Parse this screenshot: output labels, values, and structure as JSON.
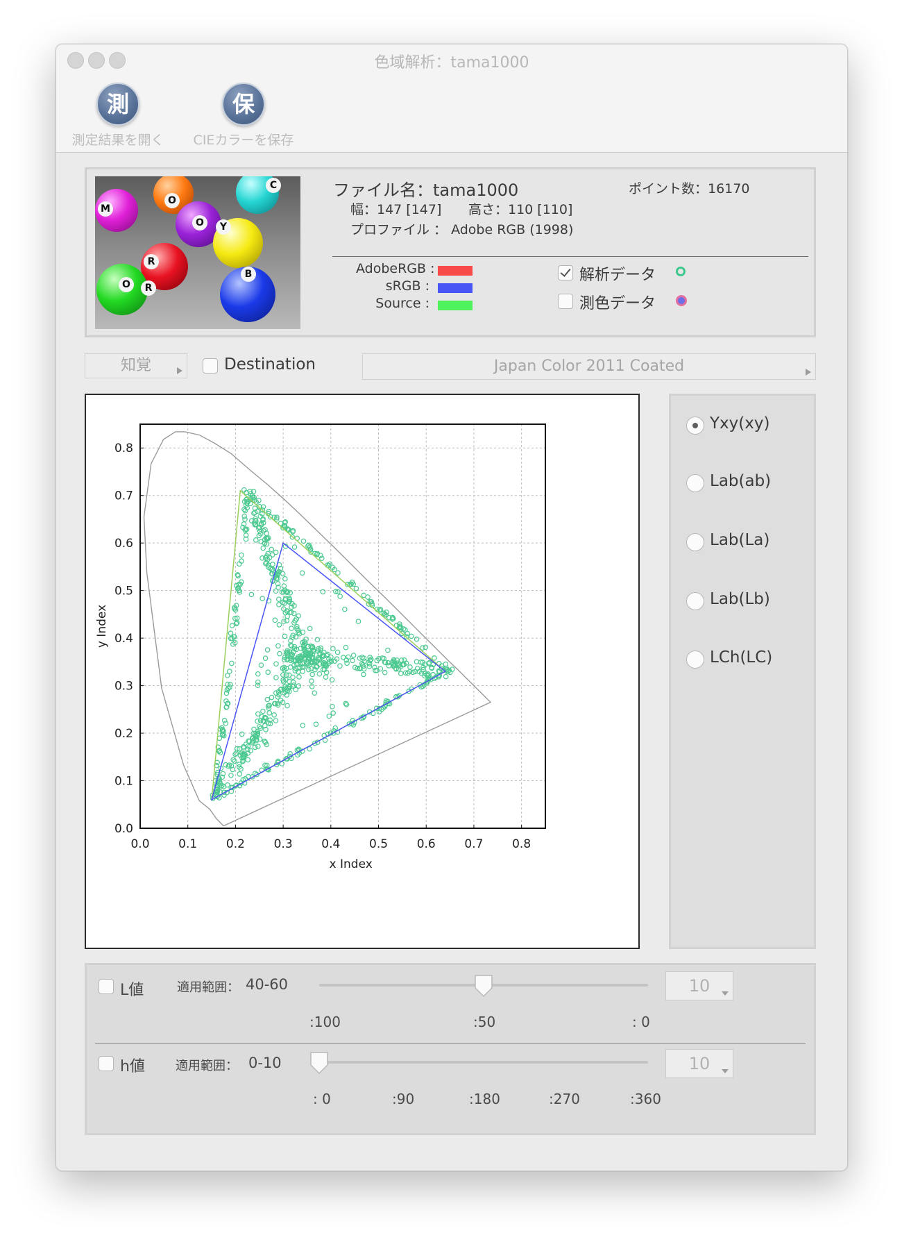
{
  "window": {
    "title": "色域解析：tama1000"
  },
  "toolbar": {
    "open_icon": "測",
    "open_label": "測定結果を開く",
    "save_icon": "保",
    "save_label": "CIEカラーを保存"
  },
  "info": {
    "file_label": "ファイル名：tama1000",
    "point_count": "ポイント数：16170",
    "size": "幅：147 [147]",
    "height": "高さ：110 [110]",
    "profile": "プロファイル ： Adobe RGB (1998)",
    "ball_letters": [
      "M",
      "O",
      "C",
      "R",
      "Y",
      "B",
      "O",
      "R",
      "O"
    ],
    "legend": [
      {
        "label": "AdobeRGB :",
        "color": "#f94a4a"
      },
      {
        "label": "sRGB :",
        "color": "#4a55f5"
      },
      {
        "label": "Source :",
        "color": "#4ef25a"
      }
    ],
    "analysis_data": {
      "label": "解析データ",
      "checked": true,
      "marker_color": "#3cc88c"
    },
    "measured_data": {
      "label": "測色データ",
      "checked": false,
      "marker_color": "#e06fa0"
    }
  },
  "controls": {
    "intent": "知覚",
    "destination_label": "Destination",
    "destination_checked": false,
    "profile_select": "Japan Color 2011 Coated"
  },
  "chart_data": {
    "type": "scatter",
    "title": "",
    "xlabel": "x Index",
    "ylabel": "y Index",
    "xlim": [
      0.0,
      0.85
    ],
    "ylim": [
      0.0,
      0.85
    ],
    "xticks": [
      "0.0",
      "0.1",
      "0.2",
      "0.3",
      "0.4",
      "0.5",
      "0.6",
      "0.7",
      "0.8"
    ],
    "yticks": [
      "0.0",
      "0.1",
      "0.2",
      "0.3",
      "0.4",
      "0.5",
      "0.6",
      "0.7",
      "0.8"
    ],
    "grid": true,
    "spectral_locus": [
      [
        0.175,
        0.005
      ],
      [
        0.17,
        0.01
      ],
      [
        0.16,
        0.02
      ],
      [
        0.146,
        0.04
      ],
      [
        0.124,
        0.058
      ],
      [
        0.091,
        0.133
      ],
      [
        0.045,
        0.295
      ],
      [
        0.014,
        0.538
      ],
      [
        0.008,
        0.655
      ],
      [
        0.023,
        0.767
      ],
      [
        0.049,
        0.818
      ],
      [
        0.074,
        0.834
      ],
      [
        0.094,
        0.834
      ],
      [
        0.125,
        0.827
      ],
      [
        0.156,
        0.81
      ],
      [
        0.191,
        0.788
      ],
      [
        0.23,
        0.754
      ],
      [
        0.266,
        0.724
      ],
      [
        0.302,
        0.692
      ],
      [
        0.337,
        0.659
      ],
      [
        0.373,
        0.624
      ],
      [
        0.409,
        0.589
      ],
      [
        0.444,
        0.554
      ],
      [
        0.479,
        0.519
      ],
      [
        0.513,
        0.486
      ],
      [
        0.547,
        0.452
      ],
      [
        0.575,
        0.424
      ],
      [
        0.603,
        0.396
      ],
      [
        0.627,
        0.372
      ],
      [
        0.648,
        0.351
      ],
      [
        0.666,
        0.334
      ],
      [
        0.681,
        0.319
      ],
      [
        0.693,
        0.307
      ],
      [
        0.703,
        0.297
      ],
      [
        0.714,
        0.286
      ],
      [
        0.735,
        0.265
      ],
      [
        0.175,
        0.005
      ]
    ],
    "series": [
      {
        "name": "AdobeRGB",
        "color": "#9bd05a",
        "points": [
          [
            0.64,
            0.33
          ],
          [
            0.21,
            0.71
          ],
          [
            0.15,
            0.06
          ]
        ]
      },
      {
        "name": "sRGB",
        "color": "#4a55f5",
        "points": [
          [
            0.64,
            0.33
          ],
          [
            0.3,
            0.6
          ],
          [
            0.15,
            0.06
          ]
        ]
      },
      {
        "name": "Source",
        "color": "#4ef25a",
        "points": [
          [
            0.64,
            0.33
          ],
          [
            0.21,
            0.71
          ],
          [
            0.15,
            0.06
          ]
        ]
      }
    ],
    "analysis_points": {
      "color": "#4cc990",
      "white_point": [
        0.3457,
        0.3585
      ],
      "primaries": [
        [
          0.648,
          0.331
        ],
        [
          0.228,
          0.703
        ],
        [
          0.158,
          0.068
        ]
      ]
    }
  },
  "modes": {
    "options": [
      "Yxy(xy)",
      "Lab(ab)",
      "Lab(La)",
      "Lab(Lb)",
      "LCh(LC)"
    ],
    "selected": 0
  },
  "sliders": {
    "l": {
      "label": "L値",
      "range_label": "適用範囲：",
      "range_value": "40-60",
      "value": 50,
      "ticks": [
        ":100",
        ":50",
        ": 0"
      ],
      "step": "10"
    },
    "h": {
      "label": "h値",
      "range_label": "適用範囲：",
      "range_value": "0-10",
      "value": 0,
      "ticks": [
        ": 0",
        ":90",
        ":180",
        ":270",
        ":360"
      ],
      "step": "10"
    }
  }
}
